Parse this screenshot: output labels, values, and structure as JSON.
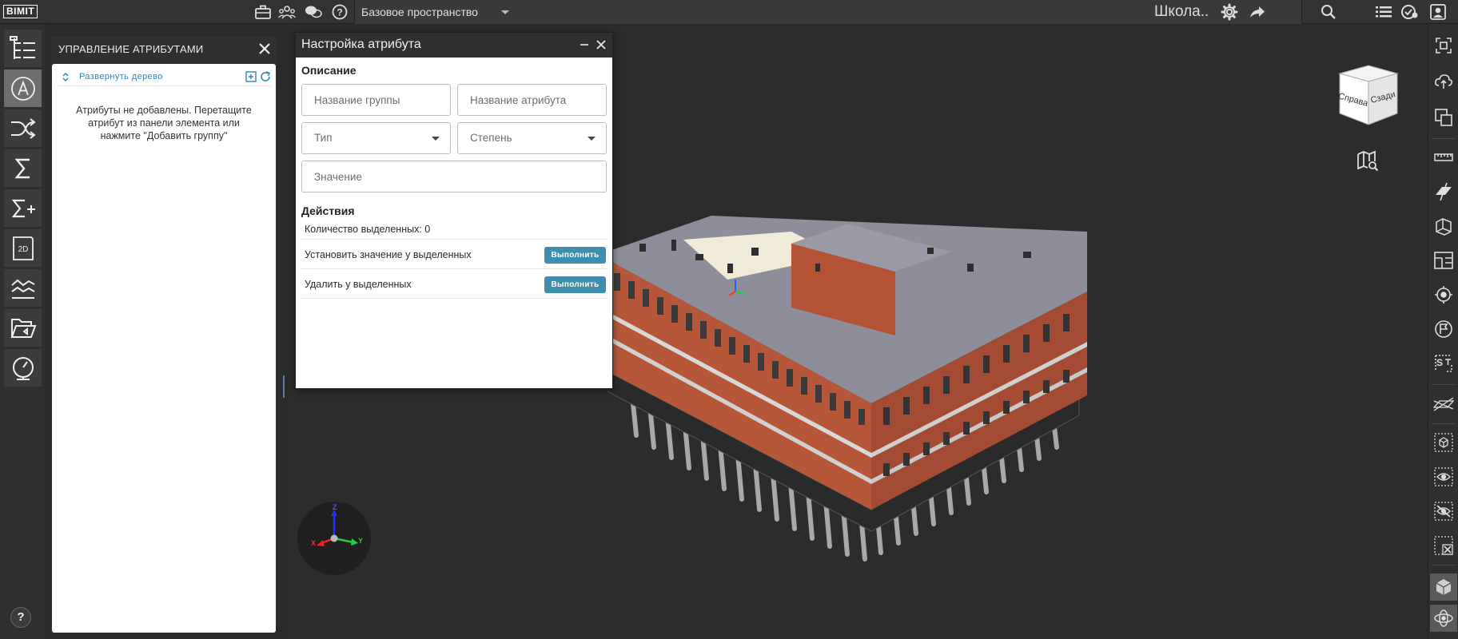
{
  "app": {
    "logo": "BIMIT",
    "workspace": "Базовое пространство",
    "model_title": "Школа.."
  },
  "attributes_panel": {
    "title": "УПРАВЛЕНИЕ АТРИБУТАМИ",
    "expand_tree": "Развернуть дерево",
    "empty_message": "Атрибуты не добавлены. Перетащите атрибут из панели элемента или нажмите \"Добавить группу\""
  },
  "dialog": {
    "title": "Настройка атрибута",
    "description_heading": "Описание",
    "group_name_placeholder": "Название группы",
    "attribute_name_placeholder": "Название атрибута",
    "type_placeholder": "Тип",
    "degree_placeholder": "Степень",
    "value_placeholder": "Значение",
    "actions_heading": "Действия",
    "selected_count": "Количество выделенных: 0",
    "actions": [
      {
        "label": "Установить значение у выделенных",
        "button": "Выполнить"
      },
      {
        "label": "Удалить у выделенных",
        "button": "Выполнить"
      }
    ]
  },
  "navcube": {
    "left_face": "Справа",
    "right_face": "Сзади"
  },
  "gizmo": {
    "x_label": "X",
    "y_label": "Y",
    "z_label": "Z"
  },
  "help": {
    "label": "?"
  },
  "colors": {
    "accent": "#3e8eae",
    "link": "#2e86c1",
    "brick": "#c05a3a",
    "roof": "#8e8e9a"
  }
}
